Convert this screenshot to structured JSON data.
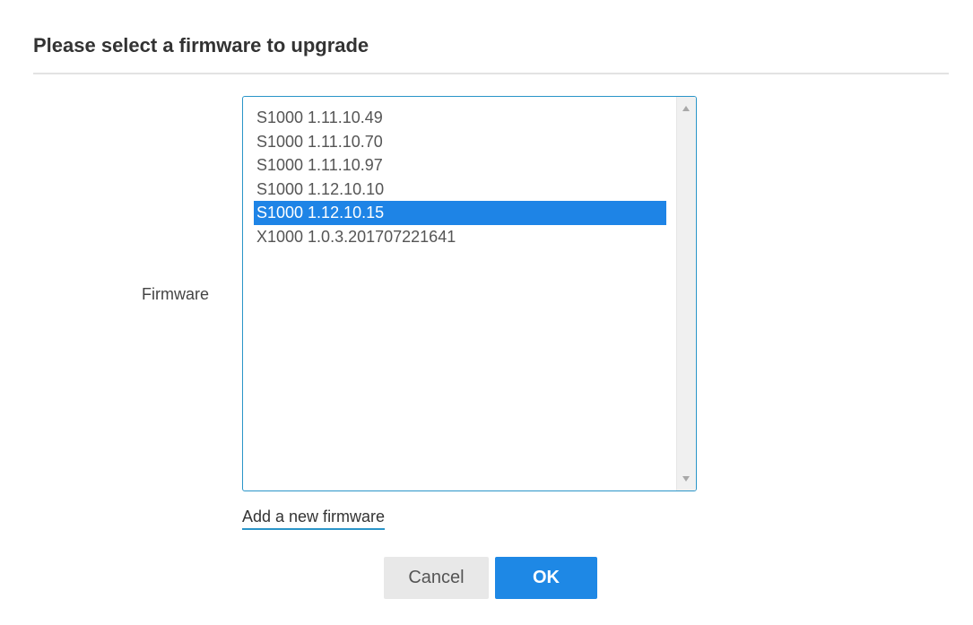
{
  "dialog": {
    "title": "Please select a firmware to upgrade"
  },
  "form": {
    "firmware_label": "Firmware",
    "firmware_options": [
      "S1000 1.11.10.49",
      "S1000 1.11.10.70",
      "S1000 1.11.10.97",
      "S1000 1.12.10.10",
      "S1000 1.12.10.15",
      "X1000 1.0.3.201707221641"
    ],
    "selected_firmware": "S1000 1.12.10.15",
    "add_link": "Add a new firmware"
  },
  "buttons": {
    "cancel": "Cancel",
    "ok": "OK"
  },
  "icons": {
    "scroll_up": "scroll-up-arrow-icon",
    "scroll_down": "scroll-down-arrow-icon"
  },
  "colors": {
    "accent": "#1e88e5",
    "selection": "#1e84e6",
    "focus_border": "#2a95c8"
  }
}
